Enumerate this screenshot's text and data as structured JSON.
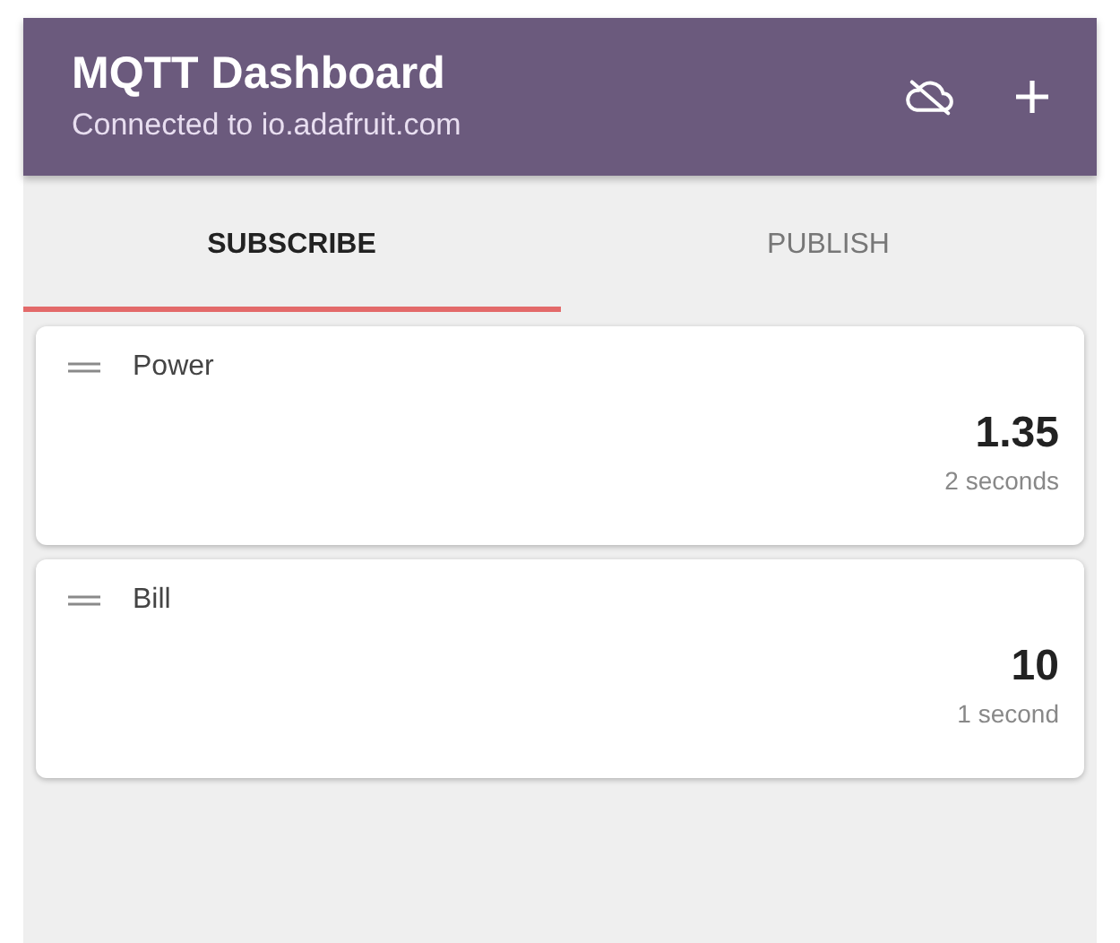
{
  "app_bar": {
    "title": "MQTT Dashboard",
    "subtitle": "Connected to io.adafruit.com"
  },
  "tabs": [
    {
      "label": "SUBSCRIBE",
      "selected": true
    },
    {
      "label": "PUBLISH",
      "selected": false
    }
  ],
  "topics": [
    {
      "name": "Power",
      "value": "1.35",
      "age": "2 seconds"
    },
    {
      "name": "Bill",
      "value": "10",
      "age": "1 second"
    }
  ]
}
